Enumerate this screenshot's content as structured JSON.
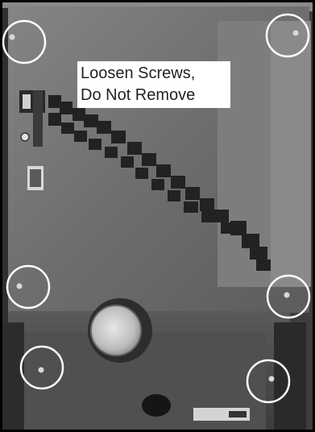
{
  "caption": {
    "line1": "Loosen Screws,",
    "line2": "Do Not Remove"
  },
  "colors": {
    "panel": "#6f6f6f",
    "panel_dark": "#4a4a4a",
    "circle_marker": "#ffffff",
    "frame": "#000000"
  },
  "markers": {
    "count": 6,
    "shape": "circle",
    "meaning": "screw locations"
  }
}
